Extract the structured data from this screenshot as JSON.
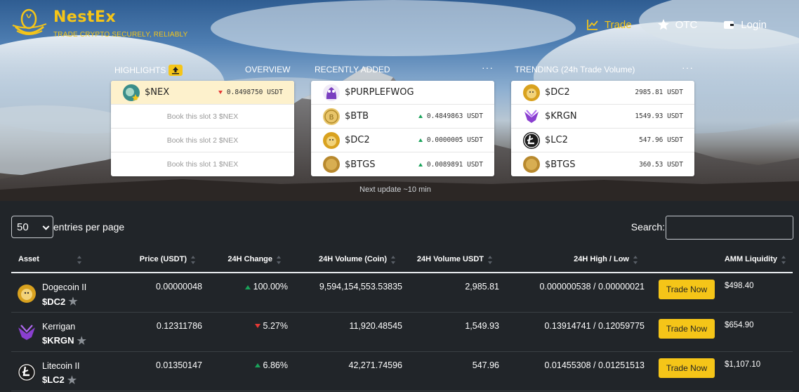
{
  "brand": {
    "name": "NestEx",
    "tagline": "TRADE CRYPTO SECURELY, RELIABLY",
    "color": "#f5c518"
  },
  "nav": {
    "trade": "Trade",
    "otc": "OTC",
    "login": "Login"
  },
  "highlights": {
    "title": "HIGHLIGHTS",
    "overview": "OVERVIEW",
    "featured": {
      "ticker": "$NEX",
      "price": "0.8498750 USDT",
      "direction": "down"
    },
    "slots": [
      "Book this slot 3 $NEX",
      "Book this slot 2 $NEX",
      "Book this slot 1 $NEX"
    ]
  },
  "recently_added": {
    "title": "RECENTLY ADDED",
    "more": "···",
    "items": [
      {
        "ticker": "$PURPLEFWOG",
        "price": "",
        "icon": "purple-frog-icon"
      },
      {
        "ticker": "$BTB",
        "price": "0.4849863 USDT",
        "direction": "up",
        "icon": "btb-coin-icon"
      },
      {
        "ticker": "$DC2",
        "price": "0.0000005 USDT",
        "direction": "up",
        "icon": "doge-coin-icon"
      },
      {
        "ticker": "$BTGS",
        "price": "0.0089891 USDT",
        "direction": "up",
        "icon": "btgs-coin-icon"
      }
    ]
  },
  "trending": {
    "title": "TRENDING (24h Trade Volume)",
    "more": "···",
    "items": [
      {
        "ticker": "$DC2",
        "volume": "2985.81 USDT"
      },
      {
        "ticker": "$KRGN",
        "volume": "1549.93 USDT"
      },
      {
        "ticker": "$LC2",
        "volume": "547.96 USDT"
      },
      {
        "ticker": "$BTGS",
        "volume": "360.53 USDT"
      }
    ]
  },
  "next_update": "Next update ~10 min",
  "table_controls": {
    "page_size": "50",
    "entries_label": "entries per page",
    "search_label": "Search:"
  },
  "table": {
    "headers": [
      "Asset",
      "Price (USDT)",
      "24H Change",
      "24H Volume (Coin)",
      "24H Volume USDT",
      "24H High / Low",
      "AMM Liquidity"
    ],
    "trade_label": "Trade Now",
    "rows": [
      {
        "name": "Dogecoin II",
        "ticker": "$DC2",
        "price": "0.00000048",
        "change": "100.00%",
        "dir": "up",
        "vol_coin": "9,594,154,553.53835",
        "vol_usdt": "2,985.81",
        "high_low": "0.000000538 / 0.00000021",
        "liquidity": "$498.40"
      },
      {
        "name": "Kerrigan",
        "ticker": "$KRGN",
        "price": "0.12311786",
        "change": "5.27%",
        "dir": "down",
        "vol_coin": "11,920.48545",
        "vol_usdt": "1,549.93",
        "high_low": "0.13914741 / 0.12059775",
        "liquidity": "$654.90"
      },
      {
        "name": "Litecoin II",
        "ticker": "$LC2",
        "price": "0.01350147",
        "change": "6.86%",
        "dir": "up",
        "vol_coin": "42,271.74596",
        "vol_usdt": "547.96",
        "high_low": "0.01455308 / 0.01251513",
        "liquidity": "$1,107.10"
      }
    ]
  }
}
